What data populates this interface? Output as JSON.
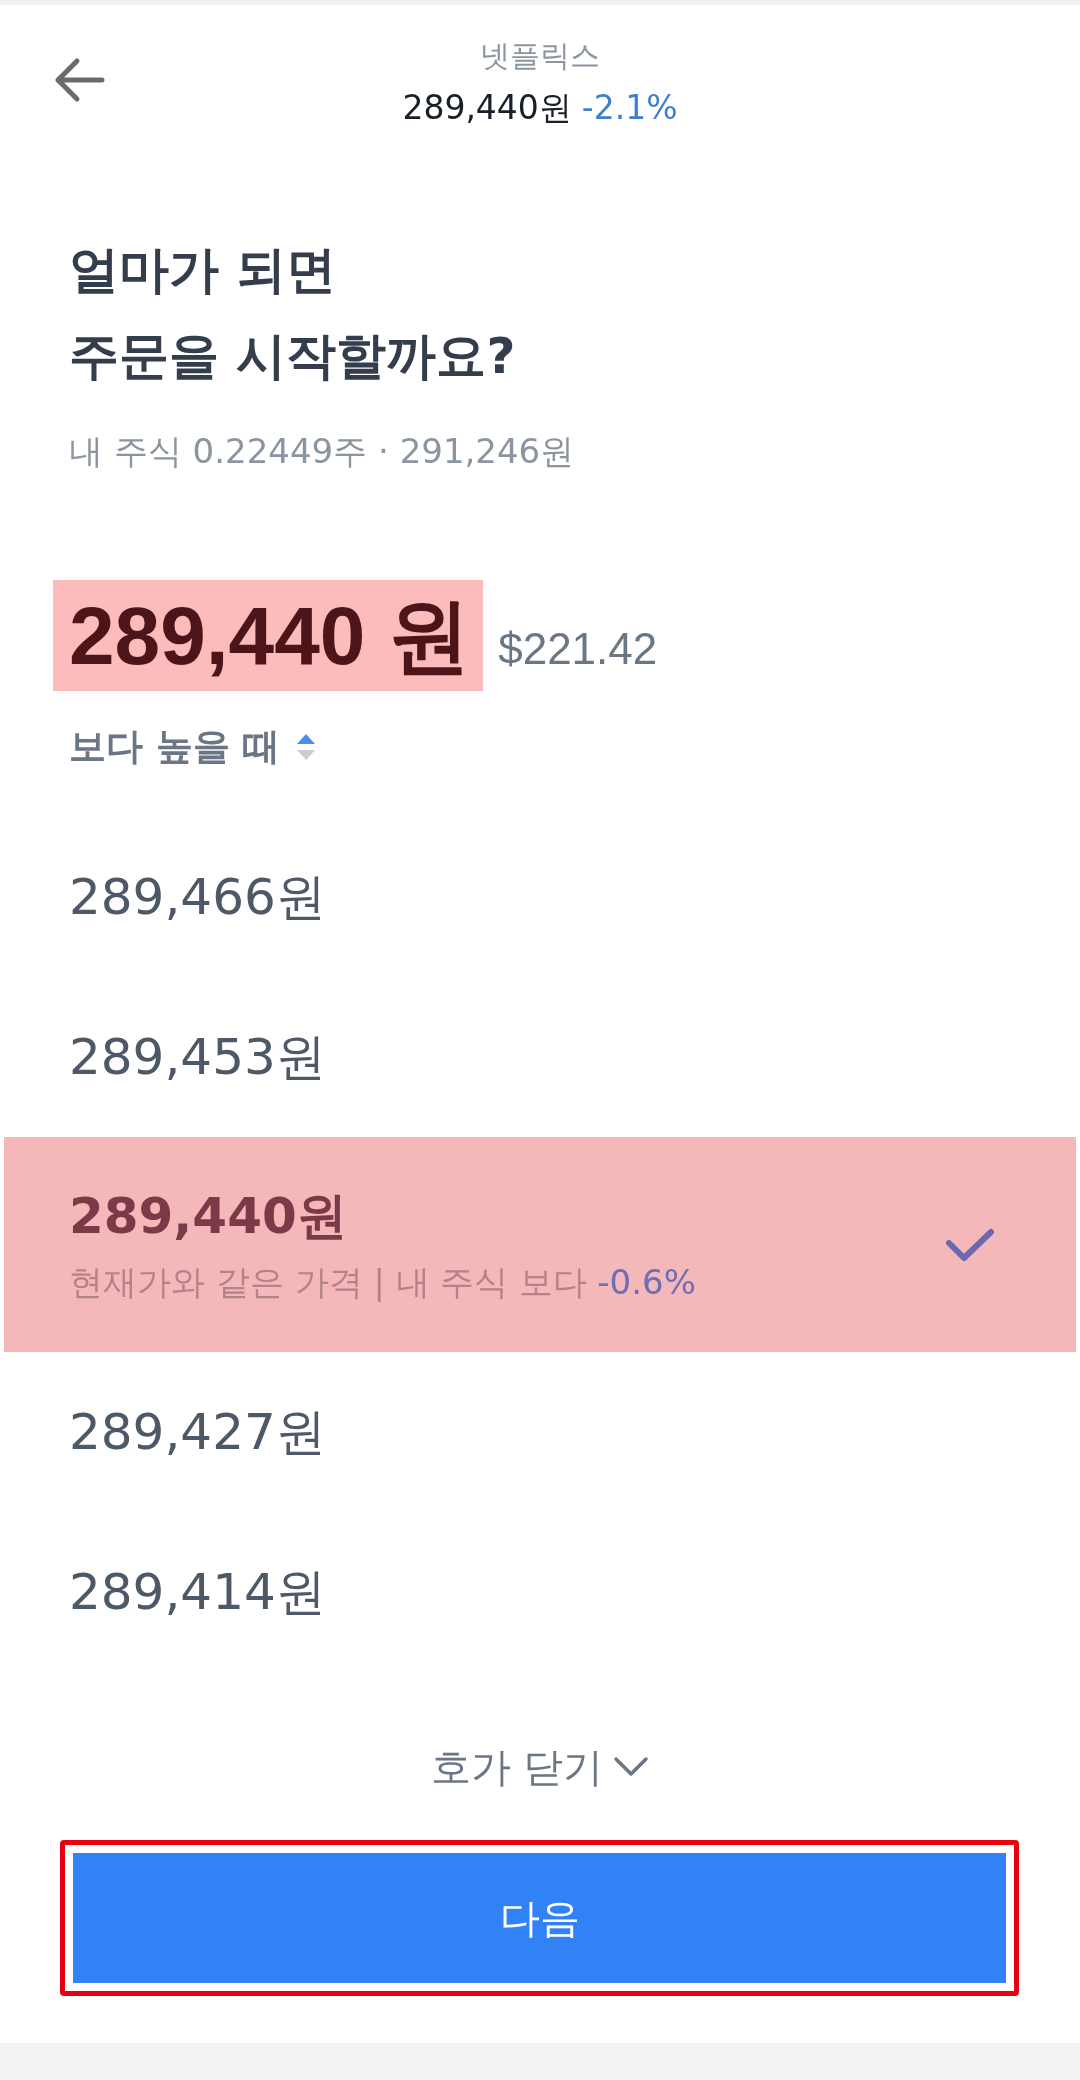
{
  "header": {
    "title": "넷플릭스",
    "price": "289,440원",
    "change": "-2.1%"
  },
  "question": {
    "lines": [
      "얼마가 되면",
      "주문을 시작할까요?"
    ],
    "holding": "내 주식 0.22449주 · 291,246원"
  },
  "target": {
    "price": "289,440 원",
    "highlighted": true,
    "usd": "$221.42",
    "condition": "보다 높을 때"
  },
  "order_book": {
    "rows": [
      {
        "price": "289,466원",
        "selected": false
      },
      {
        "price": "289,453원",
        "selected": false
      },
      {
        "price": "289,440원",
        "selected": true,
        "note": "현재가와 같은 가격 | 내 주식 보다",
        "diff": "-0.6%"
      },
      {
        "price": "289,427원",
        "selected": false
      },
      {
        "price": "289,414원",
        "selected": false
      }
    ],
    "toggle": "호가 닫기"
  },
  "next_button": {
    "label": "다음",
    "highlighted": true
  }
}
